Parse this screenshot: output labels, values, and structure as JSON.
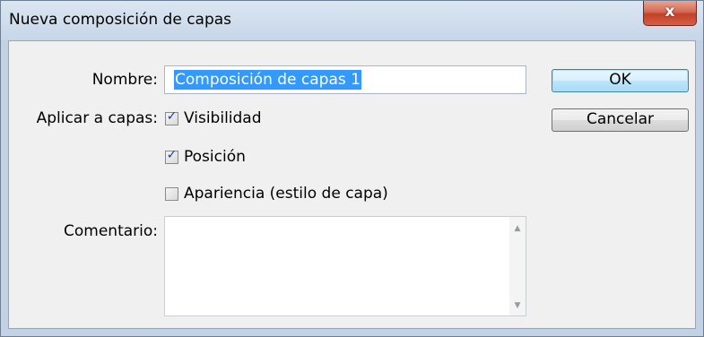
{
  "window": {
    "title": "Nueva composición de capas",
    "close_glyph": "x"
  },
  "form": {
    "name_label": "Nombre:",
    "name_value": "Composición de capas 1",
    "apply_label": "Aplicar a capas:",
    "checkboxes": [
      {
        "label": "Visibilidad",
        "checked": true
      },
      {
        "label": "Posición",
        "checked": true
      },
      {
        "label": "Apariencia (estilo de capa)",
        "checked": false
      }
    ],
    "comment_label": "Comentario:",
    "comment_value": ""
  },
  "buttons": {
    "ok": "OK",
    "cancel": "Cancelar"
  },
  "icons": {
    "check": "✓",
    "scroll_up": "▲",
    "scroll_down": "▼"
  },
  "colors": {
    "selection": "#3399ff",
    "close": "#c1412a"
  }
}
